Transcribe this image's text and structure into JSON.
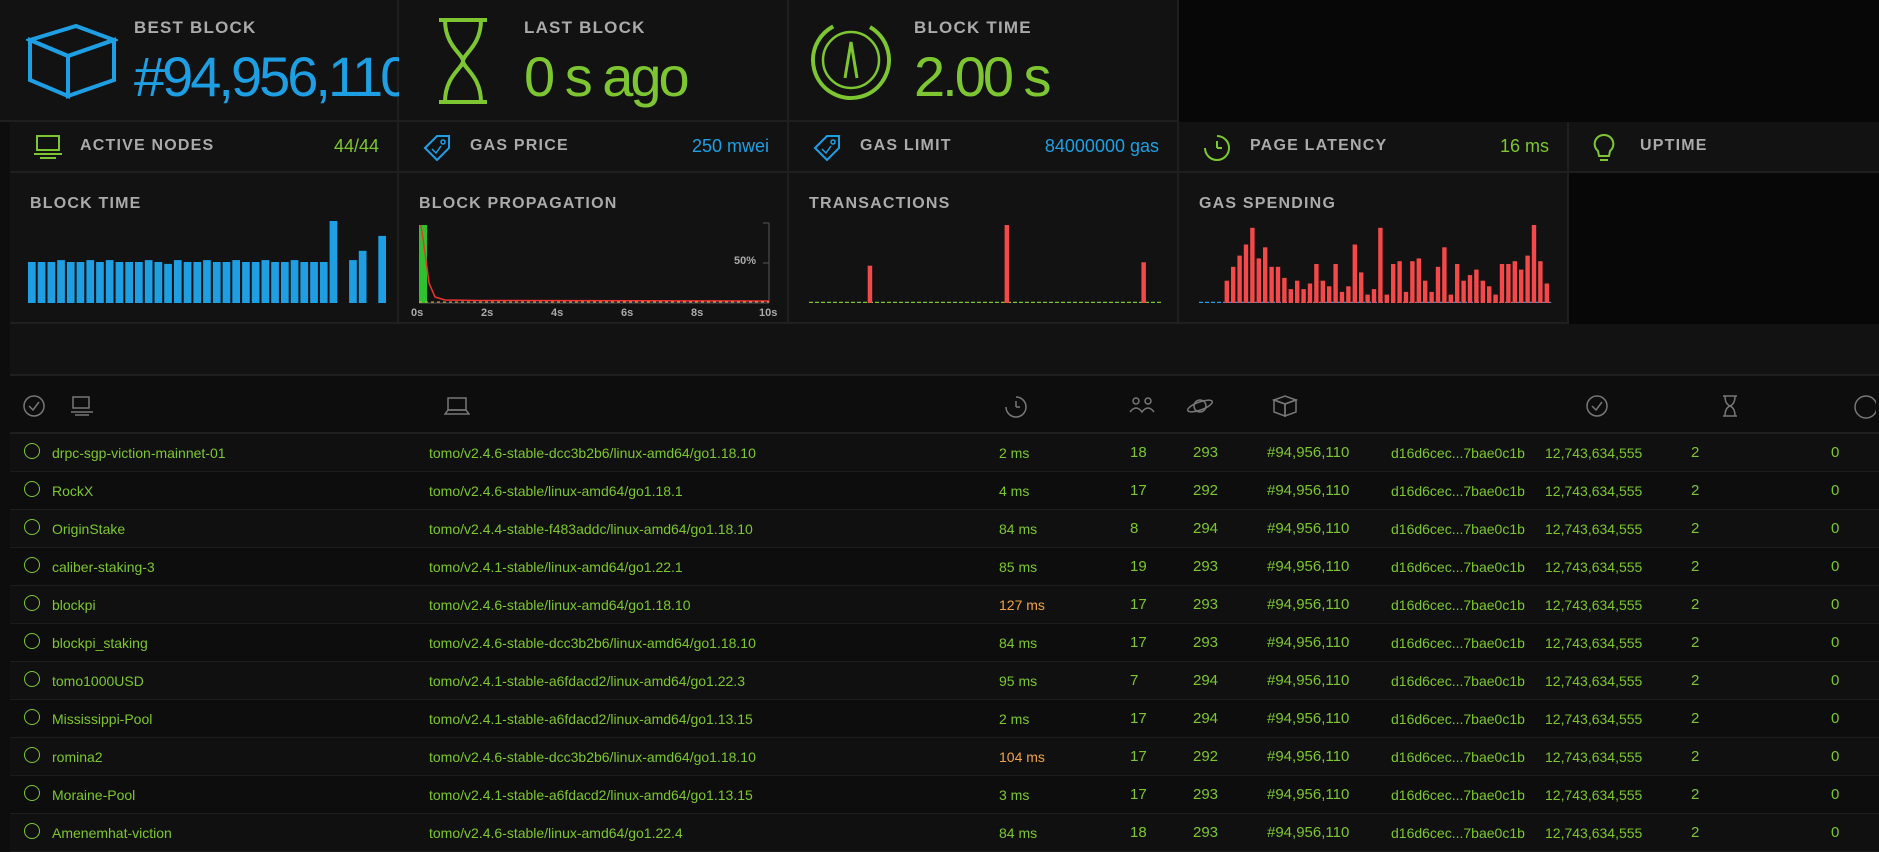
{
  "stats": {
    "best_block": {
      "label": "BEST BLOCK",
      "value": "#94,956,110"
    },
    "last_block": {
      "label": "LAST BLOCK",
      "value": "0 s ago"
    },
    "block_time": {
      "label": "BLOCK TIME",
      "value": "2.00 s"
    }
  },
  "small_stats": {
    "active_nodes": {
      "label": "ACTIVE NODES",
      "value": "44/44"
    },
    "gas_price": {
      "label": "GAS PRICE",
      "value": "250 mwei"
    },
    "gas_limit": {
      "label": "GAS LIMIT",
      "value": "84000000 gas"
    },
    "page_latency": {
      "label": "PAGE LATENCY",
      "value": "16 ms"
    },
    "uptime": {
      "label": "UPTIME"
    }
  },
  "charts": {
    "block_time": {
      "title": "BLOCK TIME"
    },
    "block_propagation": {
      "title": "BLOCK PROPAGATION",
      "pct_label": "50%",
      "ticks": [
        "0s",
        "2s",
        "4s",
        "6s",
        "8s",
        "10s"
      ]
    },
    "transactions": {
      "title": "TRANSACTIONS"
    },
    "gas_spending": {
      "title": "GAS SPENDING"
    }
  },
  "chart_data": [
    {
      "type": "bar",
      "title": "BLOCK TIME",
      "values": [
        2.2,
        2.2,
        2.2,
        2.3,
        2.2,
        2.2,
        2.3,
        2.2,
        2.3,
        2.2,
        2.2,
        2.2,
        2.3,
        2.2,
        2.1,
        2.3,
        2.2,
        2.2,
        2.3,
        2.2,
        2.2,
        2.3,
        2.2,
        2.2,
        2.3,
        2.2,
        2.2,
        2.3,
        2.2,
        2.2,
        2.2,
        4.4,
        0,
        2.3,
        2.8,
        0,
        3.6
      ]
    },
    {
      "type": "bar",
      "title": "TRANSACTIONS",
      "values": [
        0,
        0,
        0,
        0,
        1,
        1,
        1,
        1,
        1,
        11,
        0,
        0,
        0,
        0,
        0,
        0,
        0,
        0,
        0,
        0,
        0,
        0,
        0,
        0,
        0,
        1,
        1,
        1,
        1,
        1,
        23,
        1,
        0,
        1,
        1,
        0,
        1,
        0,
        1,
        0,
        0,
        0,
        0,
        0,
        1,
        1,
        1,
        0,
        0,
        1,
        1,
        12,
        1,
        0
      ]
    },
    {
      "type": "bar",
      "title": "GAS SPENDING",
      "values": [
        0,
        0,
        0,
        0,
        8,
        13,
        17,
        21,
        27,
        16,
        20,
        13,
        13,
        9,
        5,
        8,
        5,
        7,
        14,
        8,
        6,
        14,
        4,
        6,
        21,
        11,
        3,
        5,
        27,
        3,
        14,
        15,
        4,
        15,
        16,
        8,
        4,
        13,
        20,
        3,
        14,
        8,
        10,
        12,
        8,
        6,
        3,
        14,
        14,
        15,
        12,
        17,
        28,
        15,
        7
      ]
    }
  ],
  "table": {
    "rows": [
      {
        "name": "drpc-sgp-viction-mainnet-01",
        "client": "tomo/v2.4.6-stable-dcc3b2b6/linux-amd64/go1.18.10",
        "latency": "2 ms",
        "latency_slow": false,
        "peers": "18",
        "pending": "293",
        "block": "#94,956,110",
        "hash": "d16d6cec...7bae0c1b",
        "difficulty": "12,743,634,555",
        "prop": "2",
        "extra": "0"
      },
      {
        "name": "RockX",
        "client": "tomo/v2.4.6-stable/linux-amd64/go1.18.1",
        "latency": "4 ms",
        "latency_slow": false,
        "peers": "17",
        "pending": "292",
        "block": "#94,956,110",
        "hash": "d16d6cec...7bae0c1b",
        "difficulty": "12,743,634,555",
        "prop": "2",
        "extra": "0"
      },
      {
        "name": "OriginStake",
        "client": "tomo/v2.4.4-stable-f483addc/linux-amd64/go1.18.10",
        "latency": "84 ms",
        "latency_slow": false,
        "peers": "8",
        "pending": "294",
        "block": "#94,956,110",
        "hash": "d16d6cec...7bae0c1b",
        "difficulty": "12,743,634,555",
        "prop": "2",
        "extra": "0"
      },
      {
        "name": "caliber-staking-3",
        "client": "tomo/v2.4.1-stable/linux-amd64/go1.22.1",
        "latency": "85 ms",
        "latency_slow": false,
        "peers": "19",
        "pending": "293",
        "block": "#94,956,110",
        "hash": "d16d6cec...7bae0c1b",
        "difficulty": "12,743,634,555",
        "prop": "2",
        "extra": "0"
      },
      {
        "name": "blockpi",
        "client": "tomo/v2.4.6-stable/linux-amd64/go1.18.10",
        "latency": "127 ms",
        "latency_slow": true,
        "peers": "17",
        "pending": "293",
        "block": "#94,956,110",
        "hash": "d16d6cec...7bae0c1b",
        "difficulty": "12,743,634,555",
        "prop": "2",
        "extra": "0"
      },
      {
        "name": "blockpi_staking",
        "client": "tomo/v2.4.6-stable-dcc3b2b6/linux-amd64/go1.18.10",
        "latency": "84 ms",
        "latency_slow": false,
        "peers": "17",
        "pending": "293",
        "block": "#94,956,110",
        "hash": "d16d6cec...7bae0c1b",
        "difficulty": "12,743,634,555",
        "prop": "2",
        "extra": "0"
      },
      {
        "name": "tomo1000USD",
        "client": "tomo/v2.4.1-stable-a6fdacd2/linux-amd64/go1.22.3",
        "latency": "95 ms",
        "latency_slow": false,
        "peers": "7",
        "pending": "294",
        "block": "#94,956,110",
        "hash": "d16d6cec...7bae0c1b",
        "difficulty": "12,743,634,555",
        "prop": "2",
        "extra": "0"
      },
      {
        "name": "Mississippi-Pool",
        "client": "tomo/v2.4.1-stable-a6fdacd2/linux-amd64/go1.13.15",
        "latency": "2 ms",
        "latency_slow": false,
        "peers": "17",
        "pending": "294",
        "block": "#94,956,110",
        "hash": "d16d6cec...7bae0c1b",
        "difficulty": "12,743,634,555",
        "prop": "2",
        "extra": "0"
      },
      {
        "name": "romina2",
        "client": "tomo/v2.4.6-stable-dcc3b2b6/linux-amd64/go1.18.10",
        "latency": "104 ms",
        "latency_slow": true,
        "peers": "17",
        "pending": "292",
        "block": "#94,956,110",
        "hash": "d16d6cec...7bae0c1b",
        "difficulty": "12,743,634,555",
        "prop": "2",
        "extra": "0"
      },
      {
        "name": "Moraine-Pool",
        "client": "tomo/v2.4.1-stable-a6fdacd2/linux-amd64/go1.13.15",
        "latency": "3 ms",
        "latency_slow": false,
        "peers": "17",
        "pending": "293",
        "block": "#94,956,110",
        "hash": "d16d6cec...7bae0c1b",
        "difficulty": "12,743,634,555",
        "prop": "2",
        "extra": "0"
      },
      {
        "name": "Amenemhat-viction",
        "client": "tomo/v2.4.6-stable/linux-amd64/go1.22.4",
        "latency": "84 ms",
        "latency_slow": false,
        "peers": "18",
        "pending": "293",
        "block": "#94,956,110",
        "hash": "d16d6cec...7bae0c1b",
        "difficulty": "12,743,634,555",
        "prop": "2",
        "extra": "0"
      }
    ]
  },
  "colors": {
    "blue": "#1e9fe3",
    "green": "#7dc631",
    "red": "#f54848",
    "orange": "#f0a347"
  }
}
